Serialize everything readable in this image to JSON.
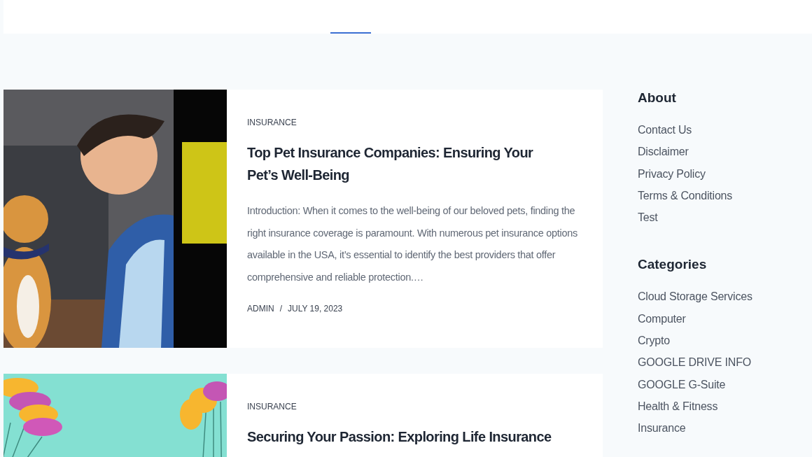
{
  "header": {
    "active_indicator": true
  },
  "posts": [
    {
      "kind": "picture",
      "category": "INSURANCE",
      "title": "Top Pet Insurance Companies: Ensuring Your Pet’s Well-Being",
      "excerpt": "Introduction: When it comes to the well-being of our beloved pets, finding the right insurance coverage is paramount. With numerous pet insurance options available in the USA, it’s essential to identify the best providers that offer comprehensive and reliable protection.…",
      "author": "ADMIN",
      "separator": "/",
      "date": "JULY 19, 2023"
    },
    {
      "kind": "picture",
      "category": "INSURANCE",
      "title": "Securing Your Passion: Exploring Life Insurance"
    }
  ],
  "sidebar": [
    {
      "title": "About",
      "links": [
        "Contact Us",
        "Disclaimer",
        "Privacy Policy",
        "Terms & Conditions",
        "Test"
      ]
    },
    {
      "title": "Categories",
      "links": [
        "Cloud Storage Services",
        "Computer",
        "Crypto",
        "GOOGLE DRIVE INFO",
        "GOOGLE G-Suite",
        "Health & Fitness",
        "Insurance"
      ]
    }
  ]
}
